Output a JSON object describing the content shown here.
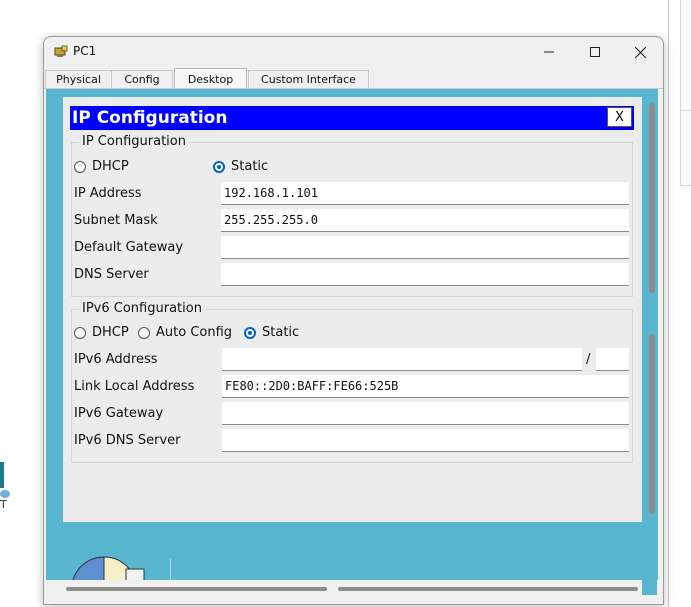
{
  "window": {
    "title": "PC1"
  },
  "tabs": [
    {
      "label": "Physical"
    },
    {
      "label": "Config"
    },
    {
      "label": "Desktop",
      "active": true
    },
    {
      "label": "Custom Interface"
    }
  ],
  "dialog": {
    "title": "IP Configuration",
    "close_label": "X",
    "ipv4": {
      "legend": "IP Configuration",
      "mode_options": [
        {
          "label": "DHCP",
          "selected": false
        },
        {
          "label": "Static",
          "selected": true
        }
      ],
      "fields": [
        {
          "label": "IP Address",
          "value": "192.168.1.101"
        },
        {
          "label": "Subnet Mask",
          "value": "255.255.255.0"
        },
        {
          "label": "Default Gateway",
          "value": ""
        },
        {
          "label": "DNS Server",
          "value": ""
        }
      ]
    },
    "ipv6": {
      "legend": "IPv6 Configuration",
      "mode_options": [
        {
          "label": "DHCP",
          "selected": false
        },
        {
          "label": "Auto Config",
          "selected": false
        },
        {
          "label": "Static",
          "selected": true
        }
      ],
      "prefix_separator": "/",
      "fields": [
        {
          "label": "IPv6 Address",
          "value": "",
          "prefix": ""
        },
        {
          "label": "Link Local Address",
          "value": "FE80::2D0:BAFF:FE66:525B"
        },
        {
          "label": "IPv6 Gateway",
          "value": ""
        },
        {
          "label": "IPv6 DNS Server",
          "value": ""
        }
      ]
    }
  },
  "colors": {
    "desktop_bg": "#58b6d0",
    "header_bg": "#0000ff",
    "radio_selected": "#0063c5"
  },
  "icons": [
    "app-pc-icon",
    "minimize-icon",
    "maximize-icon",
    "close-icon",
    "pie-chart-app-icon"
  ]
}
